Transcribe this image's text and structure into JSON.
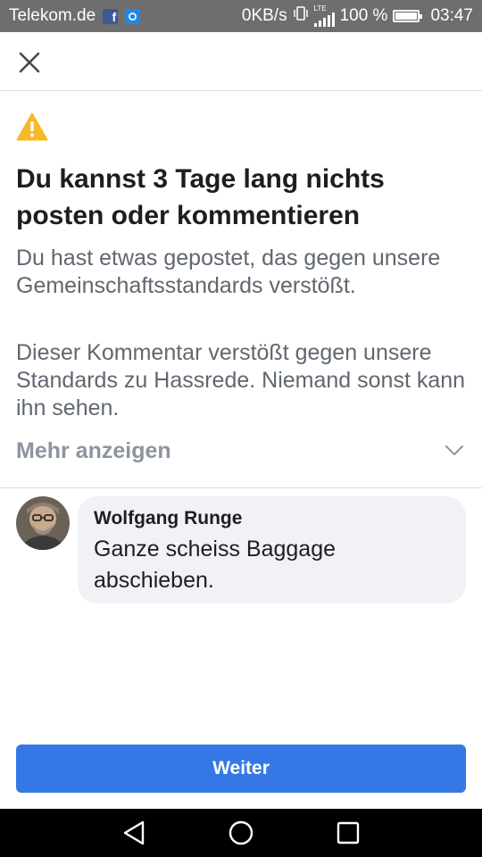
{
  "status_bar": {
    "carrier": "Telekom.de",
    "facebook_badge": "f",
    "network_speed": "0KB/s",
    "network_type": "LTE",
    "battery_percent": "100 %",
    "battery_level": 1.0,
    "time": "03:47"
  },
  "header": {
    "close_icon": "close-icon"
  },
  "notice": {
    "icon": "warning-icon",
    "icon_color": "#f7b928",
    "title": "Du kannst 3 Tage lang nichts posten oder kommentieren",
    "paragraph_1": "Du hast etwas gepostet, das gegen unsere Gemeinschaftsstandards verstößt.",
    "paragraph_2": "Dieser Kommentar verstößt gegen unsere Standards zu Hassrede. Niemand sonst kann ihn sehen.",
    "more_label": "Mehr anzeigen"
  },
  "comment": {
    "author": "Wolfgang Runge",
    "text": "Ganze scheiss Baggage abschieben."
  },
  "actions": {
    "continue_label": "Weiter",
    "button_color": "#3578e5"
  },
  "nav_bar": {
    "back_icon": "back-icon",
    "home_icon": "home-icon",
    "recents_icon": "recents-icon"
  }
}
